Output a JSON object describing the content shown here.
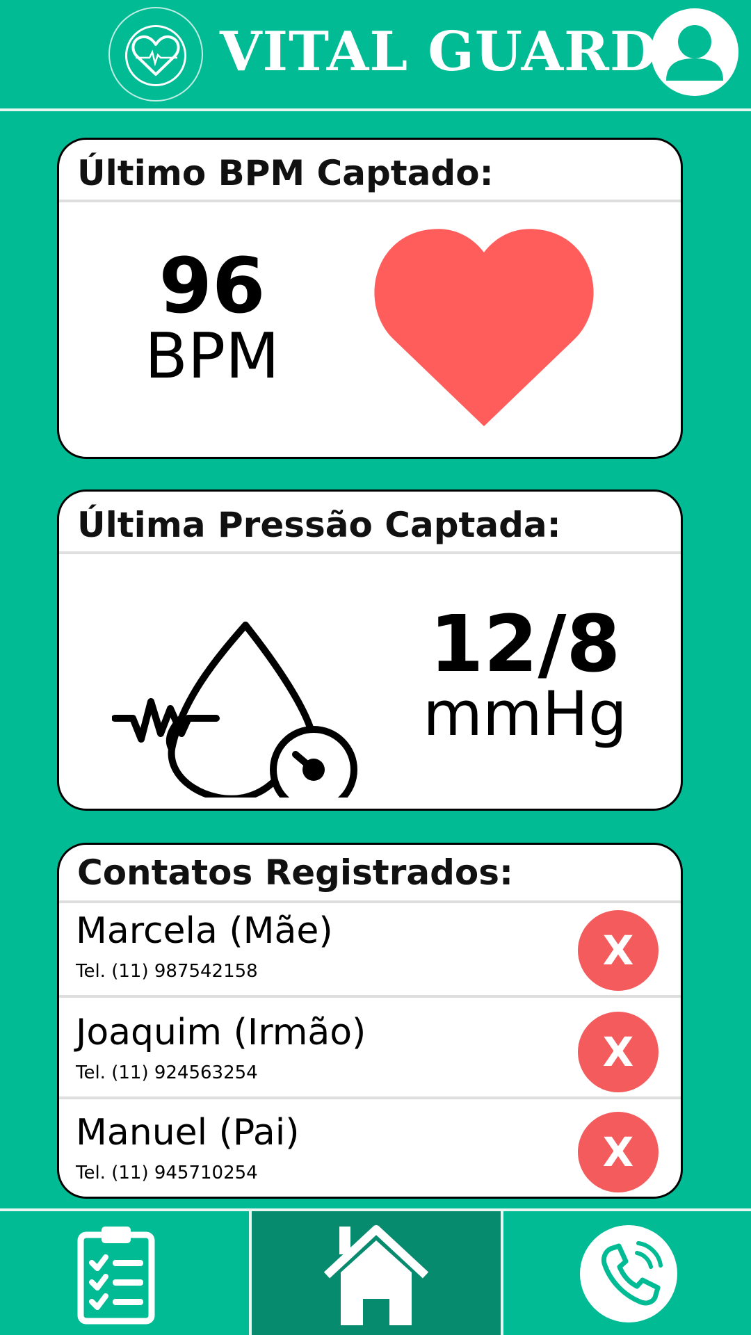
{
  "header": {
    "app_title": "VITAL GUARD",
    "logo_icon": "heart-pulse-icon",
    "profile_icon": "user-icon"
  },
  "bpm": {
    "title": "Último BPM Captado:",
    "value": "96",
    "unit": "BPM",
    "icon": "heart-icon",
    "heart_color": "#ff5c5c"
  },
  "pressure": {
    "title": "Última Pressão Captada:",
    "value": "12/8",
    "unit": "mmHg",
    "icon": "blood-pressure-icon"
  },
  "contacts": {
    "title": "Contatos Registrados:",
    "remove_label": "X",
    "items": [
      {
        "name": "Marcela (Mãe)",
        "phone": "Tel. (11) 987542158"
      },
      {
        "name": "Joaquim (Irmão)",
        "phone": "Tel. (11) 924563254"
      },
      {
        "name": "Manuel (Pai)",
        "phone": "Tel. (11) 945710254"
      }
    ]
  },
  "nav": {
    "items": [
      {
        "icon": "clipboard-checklist-icon",
        "active": false
      },
      {
        "icon": "home-icon",
        "active": true
      },
      {
        "icon": "phone-call-icon",
        "active": false
      }
    ]
  },
  "colors": {
    "background": "#00bb94",
    "nav_active": "#078b6e",
    "remove_button": "#f45b5d"
  }
}
